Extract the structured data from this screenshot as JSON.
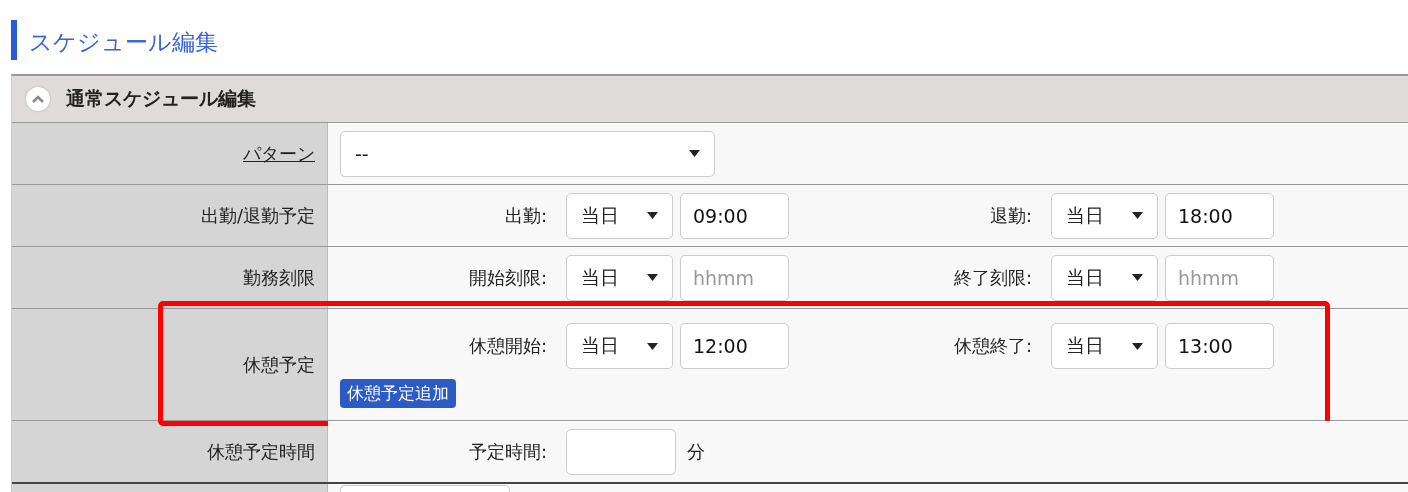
{
  "title": "スケジュール編集",
  "section": {
    "title": "通常スケジュール編集",
    "expanded": true
  },
  "rows": [
    {
      "kind": "select",
      "label": "パターン",
      "link": true,
      "highlighted": false,
      "value": "--"
    },
    {
      "kind": "time_pair",
      "label": "出勤/退勤予定",
      "link": false,
      "highlighted": false,
      "fields": [
        {
          "label": "出勤:",
          "day": "当日",
          "value": "09:00"
        },
        {
          "label": "退勤:",
          "day": "当日",
          "value": "18:00"
        }
      ]
    },
    {
      "kind": "time_pair",
      "label": "勤務刻限",
      "link": false,
      "highlighted": false,
      "fields": [
        {
          "label": "開始刻限:",
          "day": "当日",
          "placeholder": "hhmm"
        },
        {
          "label": "終了刻限:",
          "day": "当日",
          "placeholder": "hhmm"
        }
      ]
    },
    {
      "kind": "time_pair",
      "label": "休憩予定",
      "link": false,
      "highlighted": true,
      "button": "休憩予定追加",
      "fields": [
        {
          "label": "休憩開始:",
          "day": "当日",
          "value": "12:00"
        },
        {
          "label": "休憩終了:",
          "day": "当日",
          "value": "13:00"
        }
      ]
    },
    {
      "kind": "duration",
      "label": "休憩予定時間",
      "link": false,
      "highlighted": false,
      "field_label": "予定時間:",
      "unit": "分"
    }
  ]
}
